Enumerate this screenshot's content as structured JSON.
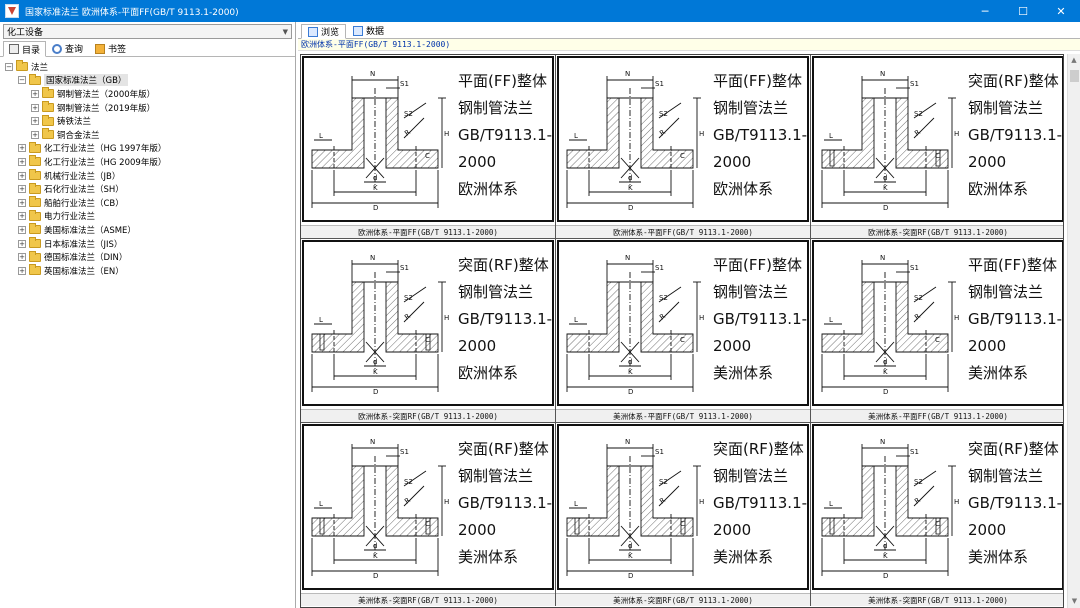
{
  "window": {
    "title": "国家标准法兰 欧洲体系-平面FF(GB/T 9113.1-2000)",
    "minimize": "─",
    "maximize": "☐",
    "close": "✕"
  },
  "left": {
    "category": "化工设备",
    "tabs": [
      {
        "label": "目录",
        "icon": "catalog-icon"
      },
      {
        "label": "查询",
        "icon": "search-icon"
      },
      {
        "label": "书签",
        "icon": "bookmark-icon"
      }
    ],
    "tree": [
      {
        "label": "法兰",
        "level": 0,
        "toggle": "−"
      },
      {
        "label": "国家标准法兰（GB）",
        "level": 1,
        "toggle": "−",
        "selected": true
      },
      {
        "label": "钢制管法兰（2000年版）",
        "level": 2,
        "toggle": "+"
      },
      {
        "label": "钢制管法兰（2019年版）",
        "level": 2,
        "toggle": "+"
      },
      {
        "label": "铸铁法兰",
        "level": 2,
        "toggle": "+"
      },
      {
        "label": "铜合金法兰",
        "level": 2,
        "toggle": "+"
      },
      {
        "label": "化工行业法兰（HG 1997年版）",
        "level": 1,
        "toggle": "+"
      },
      {
        "label": "化工行业法兰（HG 2009年版）",
        "level": 1,
        "toggle": "+"
      },
      {
        "label": "机械行业法兰（JB）",
        "level": 1,
        "toggle": "+"
      },
      {
        "label": "石化行业法兰（SH）",
        "level": 1,
        "toggle": "+"
      },
      {
        "label": "船舶行业法兰（CB）",
        "level": 1,
        "toggle": "+"
      },
      {
        "label": "电力行业法兰",
        "level": 1,
        "toggle": "+"
      },
      {
        "label": "美国标准法兰（ASME）",
        "level": 1,
        "toggle": "+"
      },
      {
        "label": "日本标准法兰（JIS）",
        "level": 1,
        "toggle": "+"
      },
      {
        "label": "德国标准法兰（DIN）",
        "level": 1,
        "toggle": "+"
      },
      {
        "label": "英国标准法兰（EN）",
        "level": 1,
        "toggle": "+"
      }
    ]
  },
  "right": {
    "tabs": [
      {
        "label": "浏览",
        "active": true
      },
      {
        "label": "数据",
        "active": false
      }
    ],
    "path": "欧洲体系-平面FF(GB/T 9113.1-2000)",
    "items": [
      {
        "l1": "平面(FF)整体",
        "l2": "钢制管法兰",
        "l3": "GB/T9113.1-",
        "l4": "2000",
        "l5": "欧洲体系",
        "caption": "欧洲体系-平面FF(GB/T 9113.1-2000)"
      },
      {
        "l1": "平面(FF)整体",
        "l2": "钢制管法兰",
        "l3": "GB/T9113.1-",
        "l4": "2000",
        "l5": "欧洲体系",
        "caption": "欧洲体系-平面FF(GB/T 9113.1-2000)"
      },
      {
        "l1": "突面(RF)整体",
        "l2": "钢制管法兰",
        "l3": "GB/T9113.1-",
        "l4": "2000",
        "l5": "欧洲体系",
        "caption": "欧洲体系-突面RF(GB/T 9113.1-2000)"
      },
      {
        "l1": "突面(RF)整体",
        "l2": "钢制管法兰",
        "l3": "GB/T9113.1-",
        "l4": "2000",
        "l5": "欧洲体系",
        "caption": "欧洲体系-突面RF(GB/T 9113.1-2000)"
      },
      {
        "l1": "平面(FF)整体",
        "l2": "钢制管法兰",
        "l3": "GB/T9113.1-",
        "l4": "2000",
        "l5": "美洲体系",
        "caption": "美洲体系-平面FF(GB/T 9113.1-2000)"
      },
      {
        "l1": "平面(FF)整体",
        "l2": "钢制管法兰",
        "l3": "GB/T9113.1-",
        "l4": "2000",
        "l5": "美洲体系",
        "caption": "美洲体系-平面FF(GB/T 9113.1-2000)"
      },
      {
        "l1": "突面(RF)整体",
        "l2": "钢制管法兰",
        "l3": "GB/T9113.1-",
        "l4": "2000",
        "l5": "美洲体系",
        "caption": "美洲体系-突面RF(GB/T 9113.1-2000)"
      },
      {
        "l1": "突面(RF)整体",
        "l2": "钢制管法兰",
        "l3": "GB/T9113.1-",
        "l4": "2000",
        "l5": "美洲体系",
        "caption": "美洲体系-突面RF(GB/T 9113.1-2000)"
      },
      {
        "l1": "突面(RF)整体",
        "l2": "钢制管法兰",
        "l3": "GB/T9113.1-",
        "l4": "2000",
        "l5": "美洲体系",
        "caption": "美洲体系-突面RF(GB/T 9113.1-2000)"
      }
    ]
  }
}
